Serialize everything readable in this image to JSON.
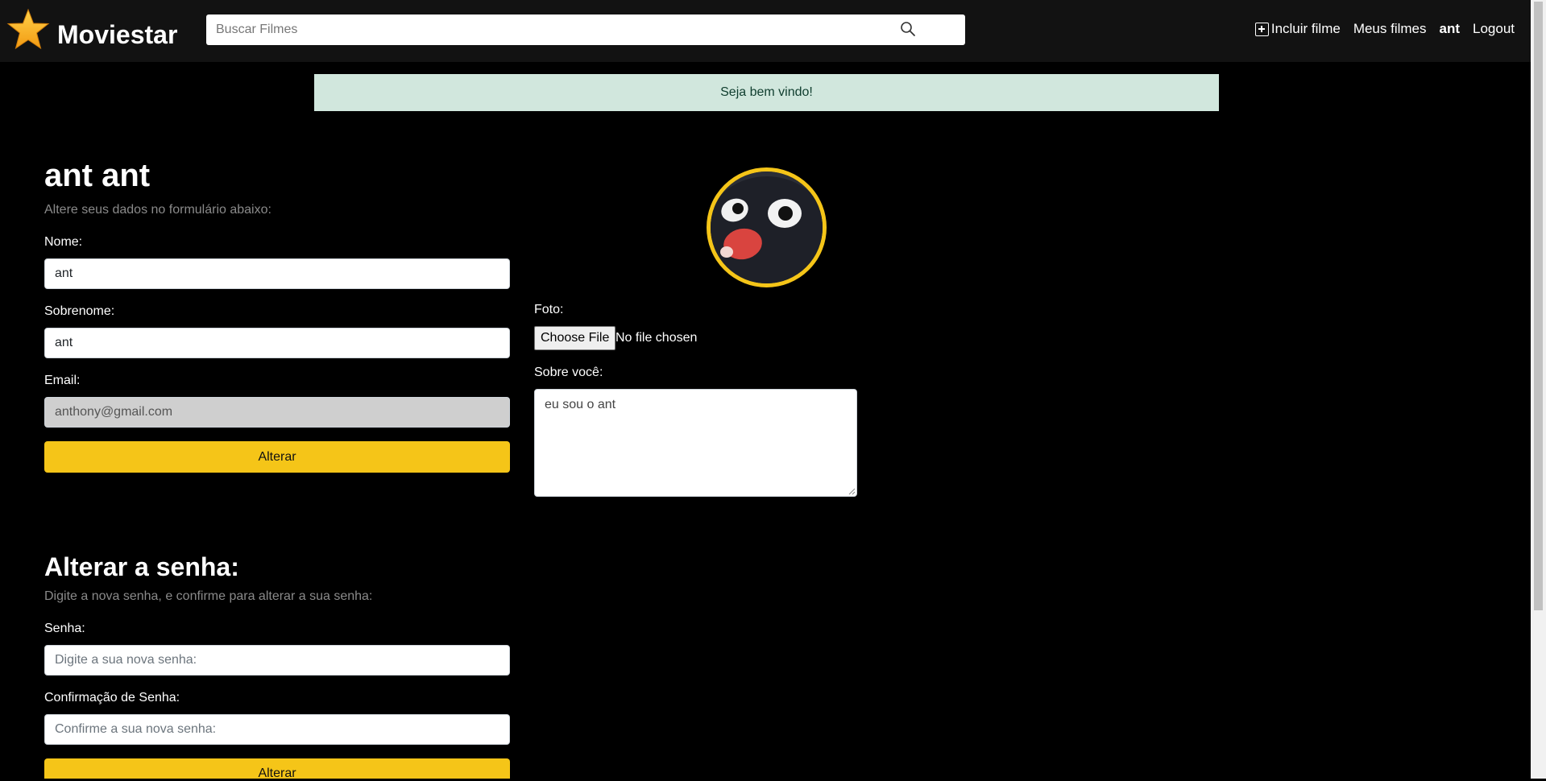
{
  "header": {
    "brand": "Moviestar",
    "search_placeholder": "Buscar Filmes",
    "nav": {
      "add_movie": "Incluir filme",
      "my_movies": "Meus filmes",
      "user": "ant",
      "logout": "Logout"
    }
  },
  "alert": {
    "message": "Seja bem vindo!"
  },
  "profile": {
    "title": "ant ant",
    "subtitle": "Altere seus dados no formulário abaixo:",
    "name_label": "Nome:",
    "name_value": "ant",
    "surname_label": "Sobrenome:",
    "surname_value": "ant",
    "email_label": "Email:",
    "email_value": "anthony@gmail.com",
    "submit_label": "Alterar",
    "photo_label": "Foto:",
    "file_button": "Choose File",
    "file_status": "No file chosen",
    "bio_label": "Sobre você:",
    "bio_value": "eu sou o ant"
  },
  "password": {
    "title": "Alterar a senha:",
    "subtitle": "Digite a nova senha, e confirme para alterar a sua senha:",
    "password_label": "Senha:",
    "password_placeholder": "Digite a sua nova senha:",
    "confirm_label": "Confirmação de Senha:",
    "confirm_placeholder": "Confirme a sua nova senha:",
    "submit_label": "Alterar"
  },
  "colors": {
    "accent": "#f5c518",
    "navbar": "#121212",
    "background": "#000000",
    "alert_bg": "#d1e7dd"
  },
  "icons": [
    "star-logo-icon",
    "search-icon",
    "plus-square-icon",
    "avatar-image"
  ]
}
